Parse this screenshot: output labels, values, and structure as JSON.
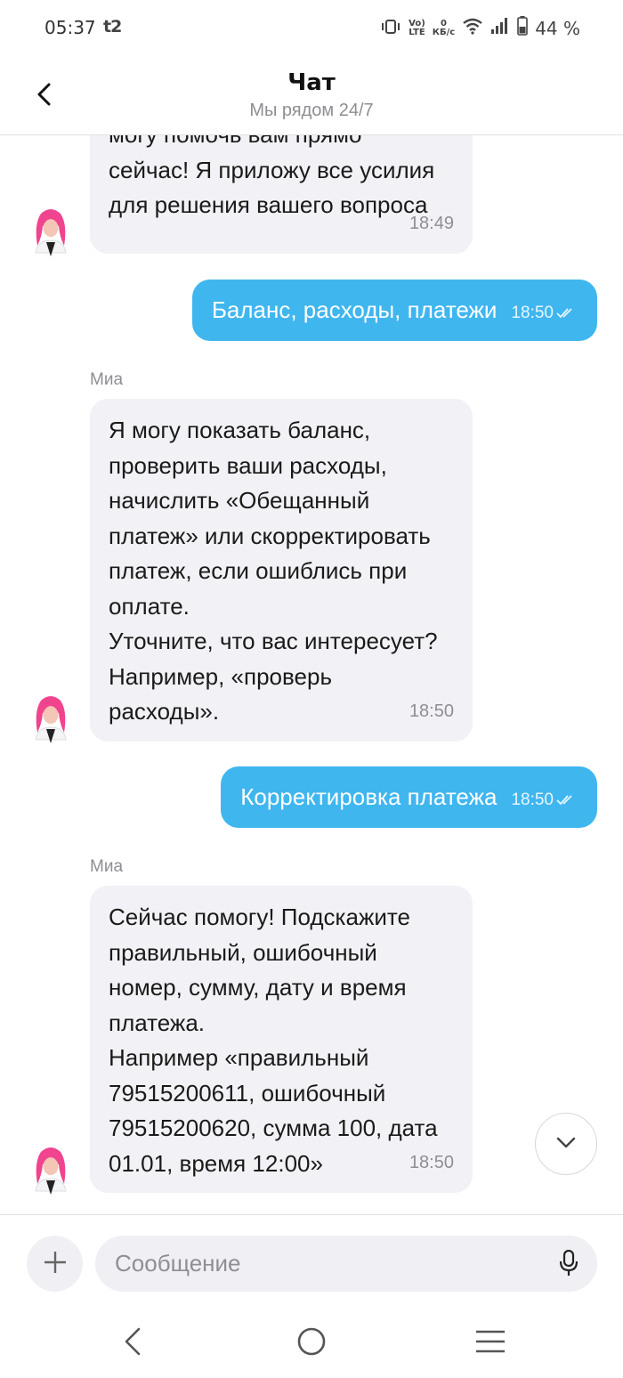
{
  "status_bar": {
    "time": "05:37",
    "carrier": "t2",
    "data_speed_value": "0",
    "data_speed_unit": "КБ/с",
    "battery": "44 %"
  },
  "header": {
    "title": "Чат",
    "subtitle": "Мы рядом 24/7"
  },
  "messages": [
    {
      "from": "bot",
      "text": "могу помочь вам прямо\nсейчас! Я приложу все усилия\nдля решения вашего вопроса",
      "time": "18:49"
    },
    {
      "from": "user",
      "text": "Баланс, расходы, платежи",
      "time": "18:50"
    },
    {
      "from": "bot",
      "sender": "Миа",
      "text": "Я могу показать баланс,\nпроверить ваши расходы,\nначислить «Обещанный\nплатеж» или скорректировать\nплатеж, если ошиблись при\nоплате.\nУточните, что вас интересует?\nНапример, «проверь\nрасходы».",
      "time": "18:50"
    },
    {
      "from": "user",
      "text": "Корректировка платежа",
      "time": "18:50"
    },
    {
      "from": "bot",
      "sender": "Миа",
      "text": "Сейчас помогу! Подскажите\nправильный, ошибочный\nномер, сумму, дату и время\nплатежа.\nНапример «правильный\n79515200611, ошибочный\n79515200620, сумма 100, дата\n01.01, время 12:00»",
      "time": "18:50"
    }
  ],
  "input": {
    "placeholder": "Сообщение"
  },
  "colors": {
    "user_bubble": "#40b6ef",
    "bot_bubble": "#f2f2f6",
    "avatar_hair": "#f0448f"
  },
  "icons": {
    "back": "back-arrow-icon",
    "add": "plus-icon",
    "mic": "microphone-icon",
    "scroll": "chevron-down-icon",
    "read": "double-check-icon"
  }
}
